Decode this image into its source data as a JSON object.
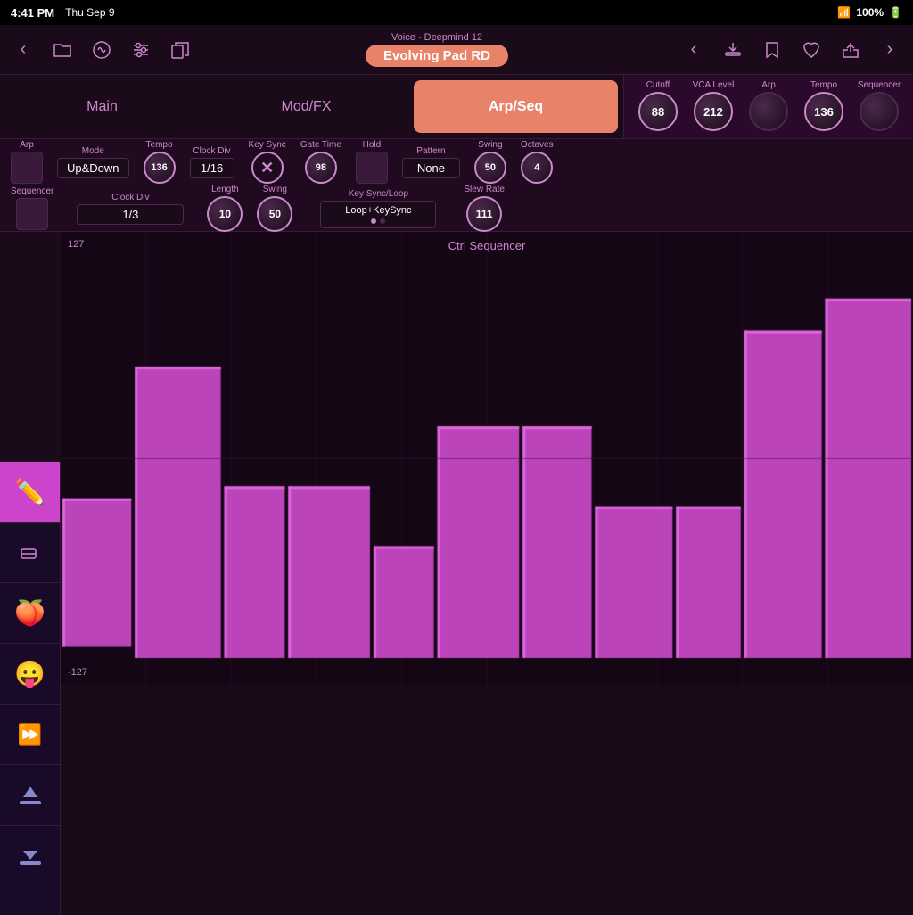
{
  "status": {
    "time": "4:41 PM",
    "date": "Thu Sep 9",
    "wifi": "WiFi",
    "battery": "100%"
  },
  "nav": {
    "subtitle": "Voice - Deepmind 12",
    "title": "Evolving Pad RD",
    "back_label": "‹",
    "forward_label": "›"
  },
  "tabs": [
    {
      "id": "main",
      "label": "Main"
    },
    {
      "id": "modfx",
      "label": "Mod/FX"
    },
    {
      "id": "arpseq",
      "label": "Arp/Seq",
      "active": true
    }
  ],
  "quick_knobs": [
    {
      "id": "cutoff",
      "label": "Cutoff",
      "value": "88"
    },
    {
      "id": "vca_level",
      "label": "VCA Level",
      "value": "212"
    },
    {
      "id": "arp",
      "label": "Arp",
      "value": ""
    },
    {
      "id": "tempo",
      "label": "Tempo",
      "value": "136"
    },
    {
      "id": "sequencer",
      "label": "Sequencer",
      "value": ""
    }
  ],
  "arp_controls": {
    "label": "Arp",
    "mode_label": "Mode",
    "mode_value": "Up&Down",
    "tempo_label": "Tempo",
    "tempo_value": "136",
    "clock_div_label": "Clock Div",
    "clock_div_value": "1/16",
    "key_sync_label": "Key Sync",
    "gate_time_label": "Gate Time",
    "gate_time_value": "98",
    "hold_label": "Hold",
    "pattern_label": "Pattern",
    "pattern_value": "None",
    "swing_label": "Swing",
    "swing_value": "50",
    "octaves_label": "Octaves",
    "octaves_value": "4"
  },
  "seq_controls": {
    "label": "Sequencer",
    "clock_div_label": "Clock Div",
    "clock_div_value": "1/3",
    "length_label": "Length",
    "length_value": "10",
    "swing_label": "Swing",
    "swing_value": "50",
    "key_sync_label": "Key Sync/Loop",
    "key_sync_value": "Loop+KeySync",
    "slew_rate_label": "Slew Rate",
    "slew_rate_value": "111"
  },
  "grid": {
    "title": "Ctrl Sequencer",
    "top_label": "127",
    "bottom_label": "-127",
    "bars": [
      {
        "start": 0,
        "end": 0.085,
        "top": 0.6,
        "height": 0.37
      },
      {
        "start": 0.085,
        "end": 0.19,
        "top": 0.27,
        "height": 0.73
      },
      {
        "start": 0.19,
        "end": 0.265,
        "top": 0.57,
        "height": 0.43
      },
      {
        "start": 0.265,
        "end": 0.365,
        "top": 0.57,
        "height": 0.43
      },
      {
        "start": 0.365,
        "end": 0.44,
        "top": 0.72,
        "height": 0.28
      },
      {
        "start": 0.44,
        "end": 0.54,
        "top": 0.42,
        "height": 0.58
      },
      {
        "start": 0.54,
        "end": 0.625,
        "top": 0.42,
        "height": 0.58
      },
      {
        "start": 0.625,
        "end": 0.72,
        "top": 0.62,
        "height": 0.38
      },
      {
        "start": 0.72,
        "end": 0.8,
        "top": 0.62,
        "height": 0.38
      },
      {
        "start": 0.8,
        "end": 0.895,
        "top": 0.18,
        "height": 0.82
      },
      {
        "start": 0.895,
        "end": 1.0,
        "top": 0.1,
        "height": 0.9
      }
    ]
  },
  "toolbar": {
    "tools": [
      {
        "id": "pencil",
        "icon": "✏️",
        "active": true
      },
      {
        "id": "eraser",
        "icon": "◻",
        "active": false
      },
      {
        "id": "peach",
        "icon": "🍑",
        "active": false
      },
      {
        "id": "emoji",
        "icon": "😛",
        "active": false
      },
      {
        "id": "fastforward",
        "icon": "⏩",
        "active": false
      },
      {
        "id": "upload",
        "icon": "⬆",
        "active": false
      },
      {
        "id": "download",
        "icon": "⬇",
        "active": false
      }
    ]
  },
  "colors": {
    "accent": "#e8836a",
    "knob_border": "#cc88cc",
    "bar_fill": "#bb44bb",
    "bar_border": "#dd66dd",
    "bg_dark": "#140614",
    "bg_mid": "#200a20",
    "bg_light": "#2a0a2a"
  }
}
